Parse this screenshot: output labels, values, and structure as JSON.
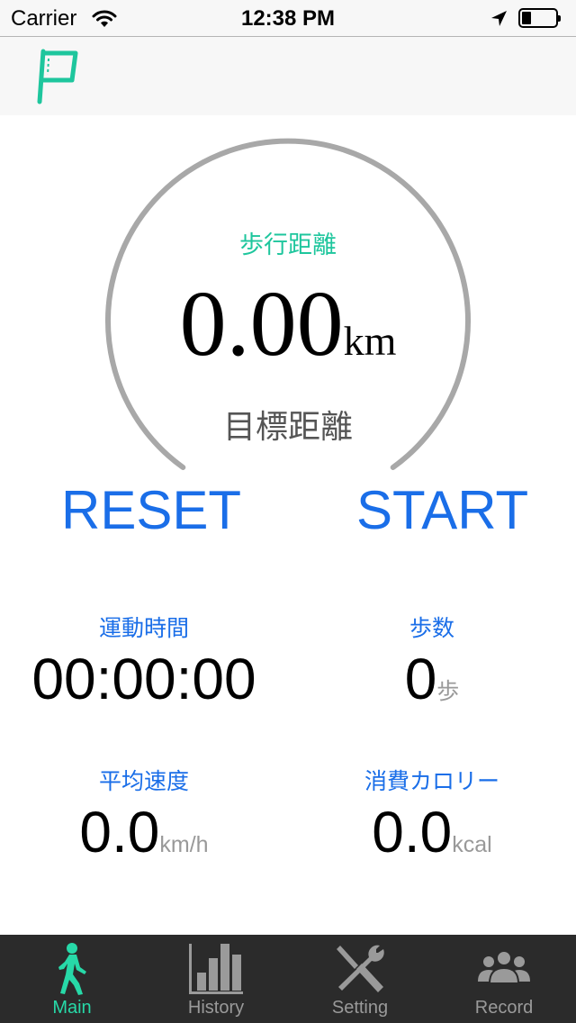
{
  "status_bar": {
    "carrier": "Carrier",
    "time": "12:38 PM"
  },
  "gauge": {
    "label": "歩行距離",
    "distance": "0.00",
    "unit": "km",
    "target_label": "目標距離",
    "progress_fraction": 0
  },
  "actions": {
    "reset": "RESET",
    "start": "START"
  },
  "stats": {
    "time": {
      "label": "運動時間",
      "value": "00:00:00"
    },
    "steps": {
      "label": "歩数",
      "value": "0",
      "unit": "歩"
    },
    "speed": {
      "label": "平均速度",
      "value": "0.0",
      "unit": "km/h"
    },
    "calories": {
      "label": "消費カロリー",
      "value": "0.0",
      "unit": "kcal"
    }
  },
  "tabs": [
    {
      "label": "Main",
      "icon": "walker-icon",
      "active": true
    },
    {
      "label": "History",
      "icon": "bar-chart-icon",
      "active": false
    },
    {
      "label": "Setting",
      "icon": "tools-icon",
      "active": false
    },
    {
      "label": "Record",
      "icon": "group-icon",
      "active": false
    }
  ],
  "colors": {
    "accent_green": "#1ec69d",
    "tab_active": "#27d9a8",
    "link_blue": "#1a6ee8",
    "gauge_track": "#a8a8a8",
    "tab_bar_bg": "#2b2b2b"
  }
}
